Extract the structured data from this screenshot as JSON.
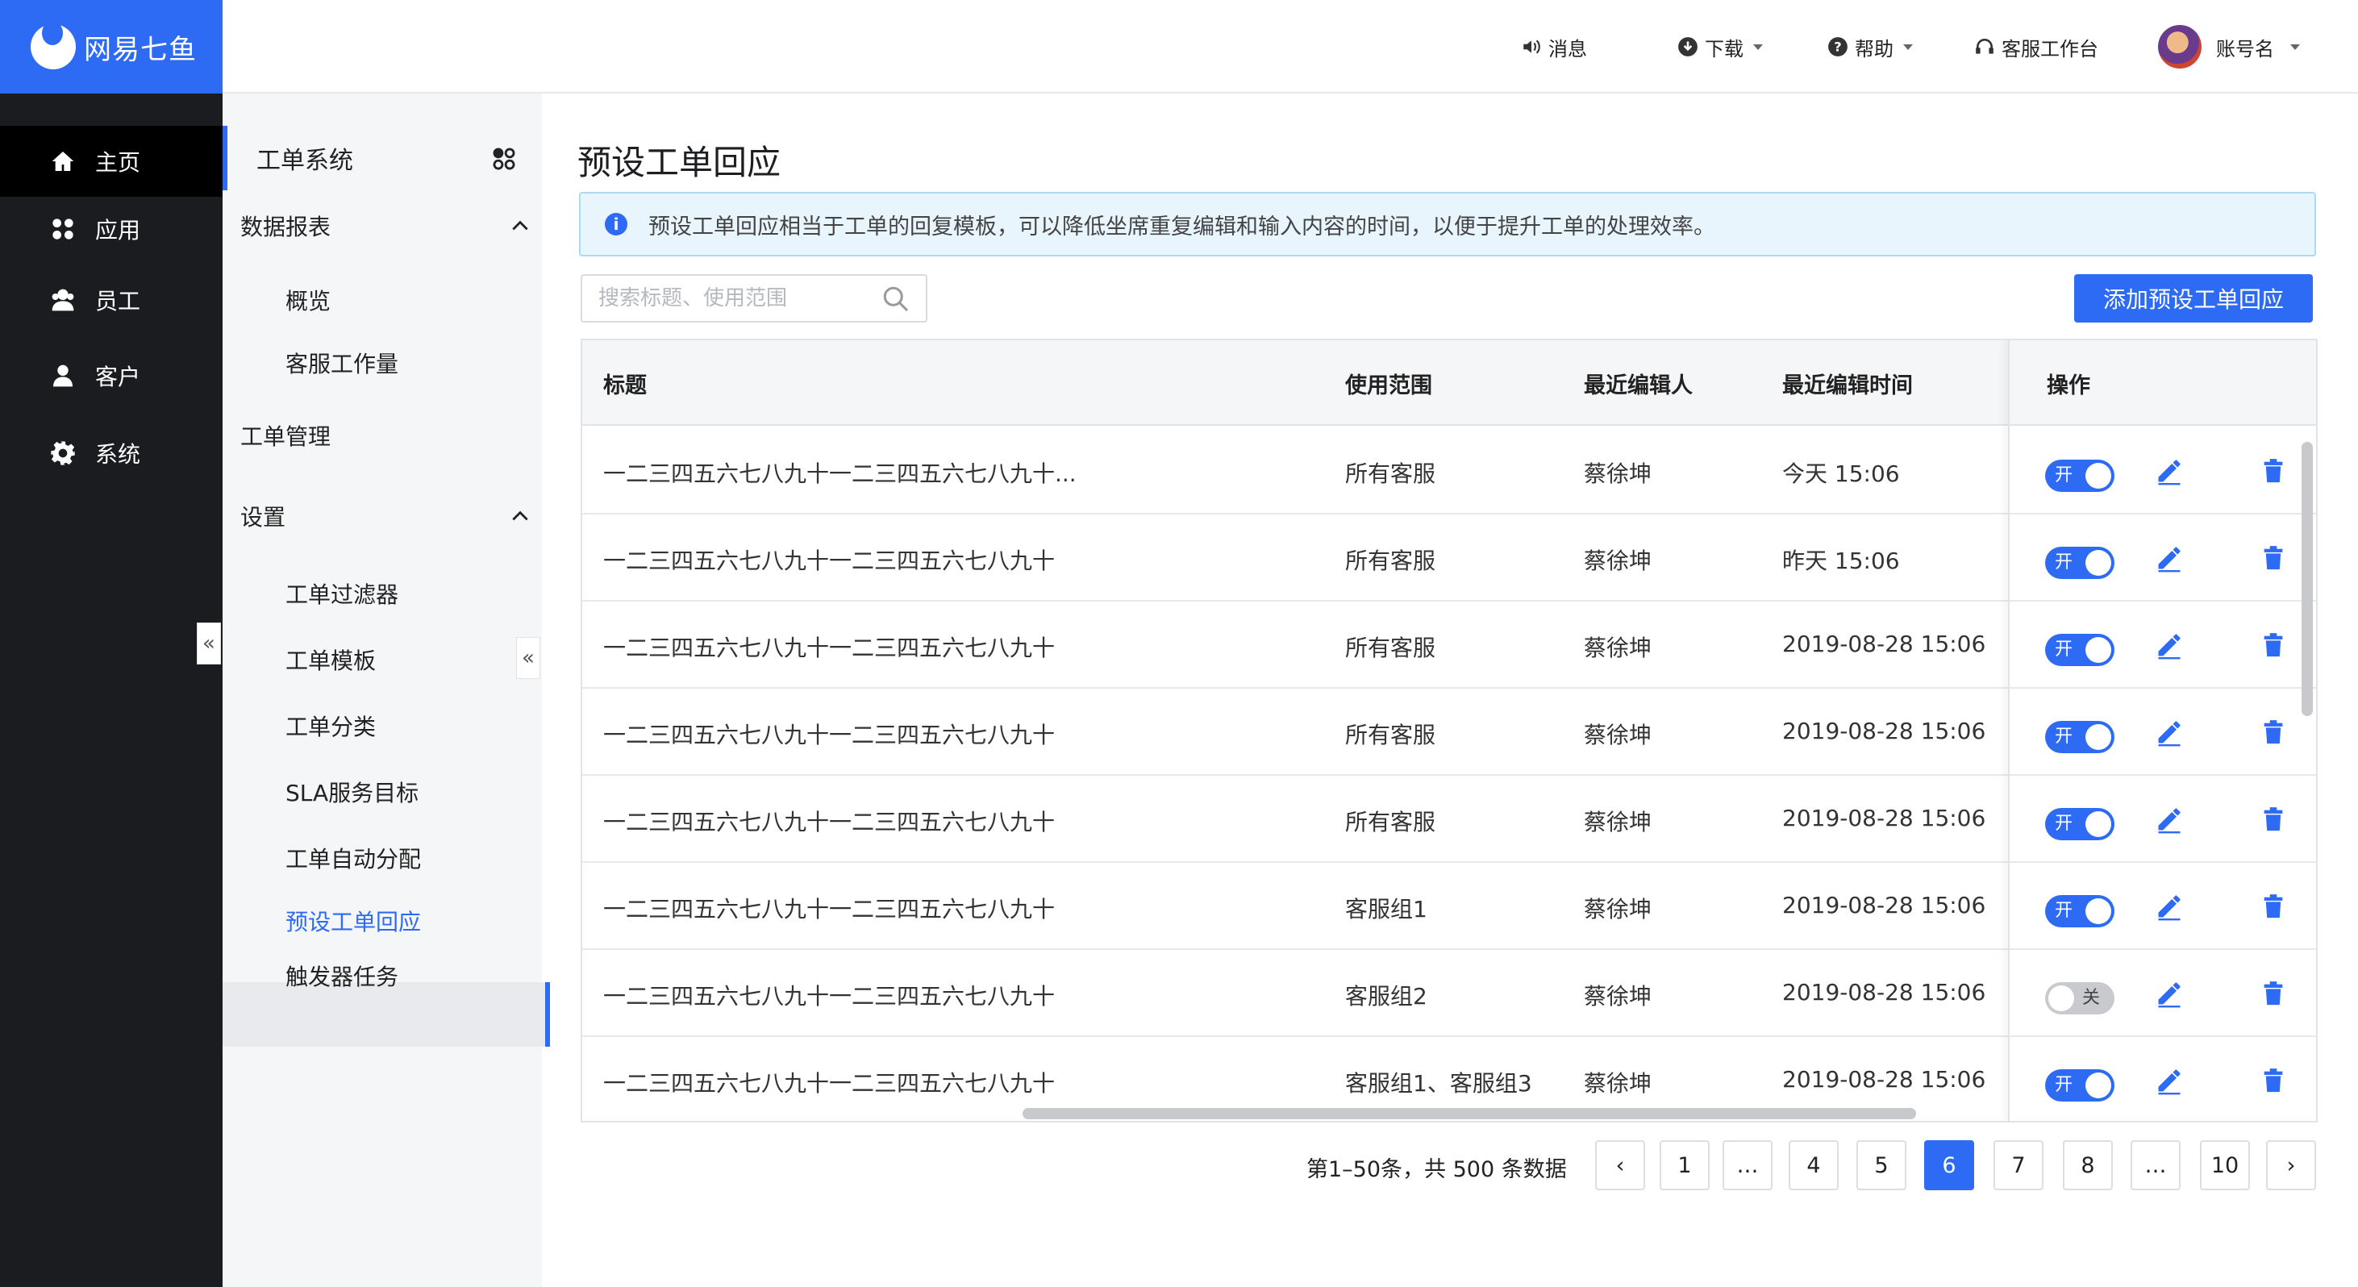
{
  "brand": {
    "name": "网易七鱼"
  },
  "rail": {
    "items": [
      {
        "label": "主页",
        "icon": "home-icon",
        "active": true
      },
      {
        "label": "应用",
        "icon": "apps-icon"
      },
      {
        "label": "员工",
        "icon": "staff-icon"
      },
      {
        "label": "客户",
        "icon": "user-icon"
      },
      {
        "label": "系统",
        "icon": "gear-icon"
      }
    ]
  },
  "topbar": {
    "messages": "消息",
    "download": "下载",
    "help": "帮助",
    "workspace": "客服工作台",
    "account": "账号名"
  },
  "subnav": {
    "header": "工单系统",
    "groups": {
      "reports": {
        "title": "数据报表",
        "items": [
          "概览",
          "客服工作量"
        ]
      },
      "manage": {
        "title": "工单管理"
      },
      "settings": {
        "title": "设置",
        "items": [
          "工单过滤器",
          "工单模板",
          "工单分类",
          "SLA服务目标",
          "工单自动分配",
          "预设工单回应",
          "触发器任务"
        ]
      }
    }
  },
  "main": {
    "title": "预设工单回应",
    "notice": "预设工单回应相当于工单的回复模板，可以降低坐席重复编辑和输入内容的时间，以便于提升工单的处理效率。",
    "search_placeholder": "搜索标题、使用范围",
    "add_button": "添加预设工单回应"
  },
  "table": {
    "headers": {
      "title": "标题",
      "scope": "使用范围",
      "editor": "最近编辑人",
      "time": "最近编辑时间",
      "ops": "操作"
    },
    "rows": [
      {
        "title": "一二三四五六七八九十一二三四五六七八九十...",
        "scope": "所有客服",
        "editor": "蔡徐坤",
        "time": "今天 15:06",
        "status": "开"
      },
      {
        "title": "一二三四五六七八九十一二三四五六七八九十",
        "scope": "所有客服",
        "editor": "蔡徐坤",
        "time": "昨天 15:06",
        "status": "开"
      },
      {
        "title": "一二三四五六七八九十一二三四五六七八九十",
        "scope": "所有客服",
        "editor": "蔡徐坤",
        "time": "2019-08-28 15:06",
        "status": "开"
      },
      {
        "title": "一二三四五六七八九十一二三四五六七八九十",
        "scope": "所有客服",
        "editor": "蔡徐坤",
        "time": "2019-08-28 15:06",
        "status": "开"
      },
      {
        "title": "一二三四五六七八九十一二三四五六七八九十",
        "scope": "所有客服",
        "editor": "蔡徐坤",
        "time": "2019-08-28 15:06",
        "status": "开"
      },
      {
        "title": "一二三四五六七八九十一二三四五六七八九十",
        "scope": "客服组1",
        "editor": "蔡徐坤",
        "time": "2019-08-28 15:06",
        "status": "开"
      },
      {
        "title": "一二三四五六七八九十一二三四五六七八九十",
        "scope": "客服组2",
        "editor": "蔡徐坤",
        "time": "2019-08-28 15:06",
        "status": "关"
      },
      {
        "title": "一二三四五六七八九十一二三四五六七八九十",
        "scope": "客服组1、客服组3",
        "editor": "蔡徐坤",
        "time": "2019-08-28 15:06",
        "status": "开"
      }
    ]
  },
  "pagination": {
    "info": "第1–50条，共 500 条数据",
    "prev": "‹",
    "next": "›",
    "pages": [
      "1",
      "…",
      "4",
      "5",
      "6",
      "7",
      "8",
      "…",
      "10"
    ],
    "current": "6"
  },
  "colors": {
    "accent": "#2d6bf5",
    "rail": "#1a1c20",
    "notice_bg": "#e8f5fc"
  }
}
